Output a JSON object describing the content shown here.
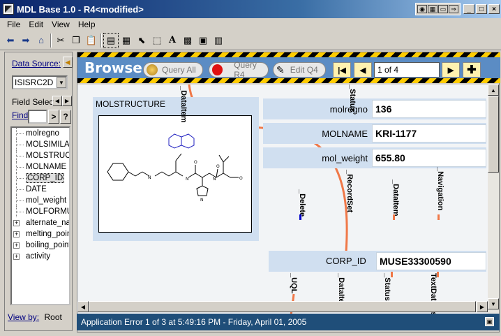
{
  "window": {
    "title": "MDL Base 1.0 - R4<modified>",
    "tray_icons": [
      "camera-icon",
      "grid-icon",
      "window-icon",
      "arrow-icon"
    ],
    "controls": {
      "minimize": "_",
      "maximize": "□",
      "close": "×"
    }
  },
  "menu": [
    "File",
    "Edit",
    "View",
    "Help"
  ],
  "toolbar": {
    "icons": [
      "back-arrow-icon",
      "forward-arrow-icon",
      "home-icon",
      "cut-icon",
      "copy-icon",
      "paste-icon",
      "select-form-icon",
      "form-layout-icon",
      "pointer-icon",
      "box-select-icon",
      "text-tool-icon",
      "grid-tool-icon",
      "box-tool-icon",
      "table-tool-icon"
    ]
  },
  "left_panel": {
    "data_source_label": "Data Source:",
    "data_source_value": "ISISRC2D",
    "field_select_label": "Field Select",
    "find_label": "Find",
    "find_go": ">",
    "find_help": "?",
    "tree_items": [
      {
        "label": "molregno",
        "type": "leaf"
      },
      {
        "label": "MOLSIMILAR",
        "type": "leaf"
      },
      {
        "label": "MOLSTRUCT",
        "type": "leaf"
      },
      {
        "label": "MOLNAME",
        "type": "leaf"
      },
      {
        "label": "CORP_ID",
        "type": "leaf",
        "selected": true
      },
      {
        "label": "DATE",
        "type": "leaf"
      },
      {
        "label": "mol_weight",
        "type": "leaf"
      },
      {
        "label": "MOLFORMU",
        "type": "leaf"
      },
      {
        "label": "alternate_nar",
        "type": "group"
      },
      {
        "label": "melting_point",
        "type": "group"
      },
      {
        "label": "boiling_point",
        "type": "group"
      },
      {
        "label": "activity",
        "type": "group"
      }
    ],
    "view_by_label": "View by:",
    "view_by_value": "Root"
  },
  "browse": {
    "title": "Browse",
    "query_all": "Query All",
    "query_r4": "Query R4",
    "edit_q4": "Edit Q4",
    "record_text": "1 of 4",
    "colors": {
      "bar": "#5b8cc4",
      "hazard_yellow": "#ffcc00",
      "nav_button": "#fff2b0"
    }
  },
  "form": {
    "structure_label": "MOLSTRUCTURE",
    "fields": {
      "molregno": {
        "label": "molregno",
        "value": "136"
      },
      "molname": {
        "label": "MOLNAME",
        "value": "KRI-1177"
      },
      "mol_weight": {
        "label": "mol_weight",
        "value": "655.80"
      },
      "corp_id": {
        "label": "CORP_ID",
        "value": "MUSE33300590"
      }
    },
    "tags": {
      "dataitem_top": "_DataItem",
      "status_top": "_Status",
      "delete": "_Delete",
      "recordset": "_RecordSet",
      "dataitem_mid": "_DataItem",
      "navigation": "_Navigation",
      "uql": "_UQL",
      "dataitem_bottom": "_DataItem",
      "status_bottom": "_Status",
      "textdatalist": "TextDataList"
    },
    "colors": {
      "connector": "#f07848",
      "panel": "#d0dff0",
      "delete_marker": "#0000cc"
    }
  },
  "status": {
    "message": "Application Error 1 of 3 at 5:49:16 PM - Friday, April 01, 2005"
  }
}
